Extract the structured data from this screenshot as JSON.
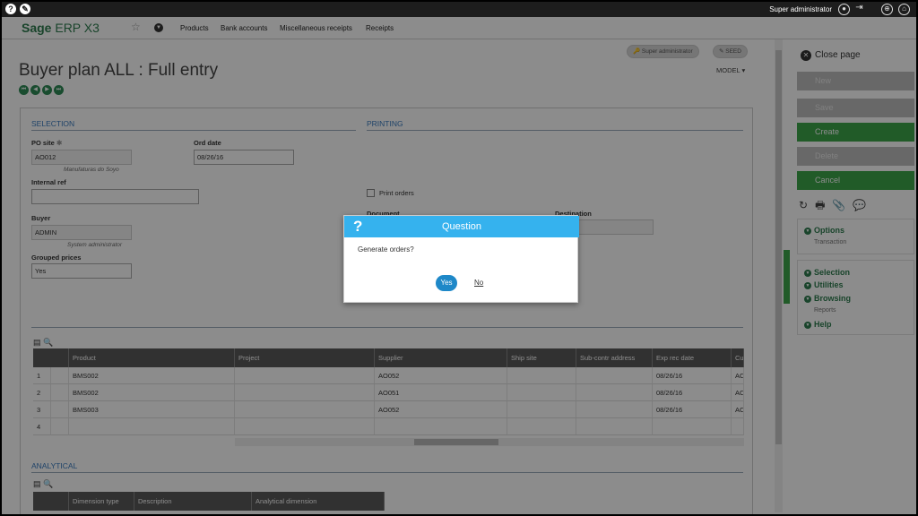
{
  "topbar": {
    "user_name": "Super administrator"
  },
  "nav": {
    "logo_bold": "Sage",
    "logo_rest": "ERP X3",
    "links": [
      "Products",
      "Bank accounts",
      "Miscellaneous receipts",
      "Receipts"
    ]
  },
  "page": {
    "title": "Buyer plan ALL : Full entry",
    "pill_user": "Super administrator",
    "pill_folder": "SEED",
    "model_label": "MODEL"
  },
  "selection": {
    "section_title": "SELECTION",
    "po_site_label": "PO site",
    "po_site_value": "AO012",
    "po_site_desc": "Manufaturas do Soyo",
    "ord_date_label": "Ord date",
    "ord_date_value": "08/26/16",
    "internal_ref_label": "Internal ref",
    "internal_ref_value": "",
    "buyer_label": "Buyer",
    "buyer_value": "ADMIN",
    "buyer_desc": "System administrator",
    "grouped_prices_label": "Grouped prices",
    "grouped_prices_value": "Yes"
  },
  "printing": {
    "section_title": "PRINTING",
    "print_orders_label": "Print orders",
    "document_label": "Document",
    "destination_label": "Destination"
  },
  "grid": {
    "columns": [
      "Product",
      "Project",
      "Supplier",
      "Ship site",
      "Sub-contr address",
      "Exp rec date",
      "Cu"
    ],
    "rows": [
      {
        "num": "1",
        "product": "BMS002",
        "supplier": "AO052",
        "date": "08/26/16",
        "cu": "AC"
      },
      {
        "num": "2",
        "product": "BMS002",
        "supplier": "AO051",
        "date": "08/26/16",
        "cu": "AC"
      },
      {
        "num": "3",
        "product": "BMS003",
        "supplier": "AO052",
        "date": "08/26/16",
        "cu": "AC"
      },
      {
        "num": "4",
        "product": "",
        "supplier": "",
        "date": "",
        "cu": ""
      }
    ]
  },
  "analytical": {
    "section_title": "ANALYTICAL",
    "columns": [
      "Dimension type",
      "Description",
      "Analytical dimension"
    ]
  },
  "right_panel": {
    "close_label": "Close page",
    "buttons": [
      "New",
      "Save",
      "Create",
      "Delete",
      "Cancel"
    ],
    "options_label": "Options",
    "transaction_label": "Transaction",
    "selection_label": "Selection",
    "utilities_label": "Utilities",
    "browsing_label": "Browsing",
    "reports_label": "Reports",
    "help_label": "Help"
  },
  "dialog": {
    "title": "Question",
    "message": "Generate orders?",
    "yes_label": "Yes",
    "no_label": "No"
  },
  "colors": {
    "accent_green": "#3ca64a",
    "dialog_blue": "#35b2ee",
    "yes_blue": "#1e88c8"
  }
}
